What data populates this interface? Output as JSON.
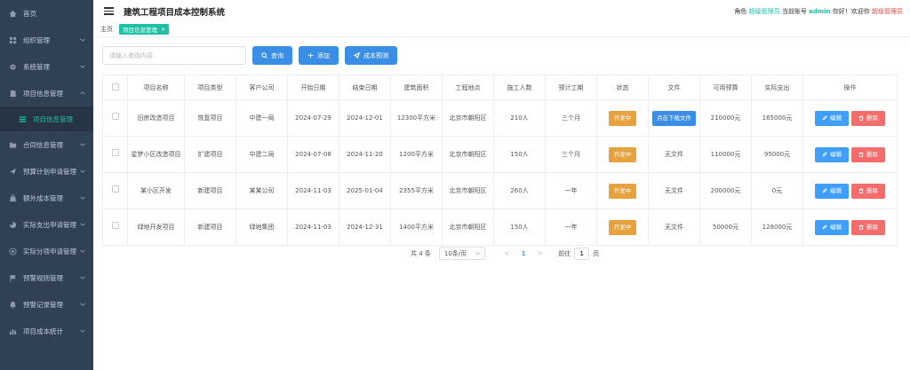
{
  "sidebar": {
    "items": [
      {
        "label": "首页",
        "icon": "home-icon"
      },
      {
        "label": "组织管理",
        "icon": "grid-icon"
      },
      {
        "label": "系统管理",
        "icon": "gear-icon"
      },
      {
        "label": "项目信息管理",
        "icon": "document-icon"
      },
      {
        "label": "项目信息管理",
        "icon": "list-icon"
      },
      {
        "label": "合同信息管理",
        "icon": "folder-icon"
      },
      {
        "label": "预算计划申请管理",
        "icon": "send-icon"
      },
      {
        "label": "额外成本管理",
        "icon": "bag-icon"
      },
      {
        "label": "实际支出申请管理",
        "icon": "pie-icon"
      },
      {
        "label": "实际分项申请管理",
        "icon": "target-icon"
      },
      {
        "label": "预警规则管理",
        "icon": "flag-icon"
      },
      {
        "label": "预警记录管理",
        "icon": "bell-icon"
      },
      {
        "label": "项目成本统计",
        "icon": "chart-icon"
      }
    ]
  },
  "header": {
    "title": "建筑工程项目成本控制系统",
    "role_prefix": "角色",
    "role": "超级管理员",
    "account_prefix": "当前账号",
    "username": "admin",
    "greeting": "你好！欢迎你",
    "logout": "超级管理员"
  },
  "breadcrumb": {
    "home": "主页",
    "tag": "项目信息管理",
    "tag_close": "×"
  },
  "toolbar": {
    "search_placeholder": "请输入查询内容",
    "search_label": "查询",
    "add_label": "添加",
    "predict_label": "成本预测"
  },
  "table": {
    "headers": [
      "",
      "项目名称",
      "项目类型",
      "客户公司",
      "开始日期",
      "结束日期",
      "建筑面积",
      "工程地点",
      "施工人数",
      "预计工期",
      "状态",
      "文件",
      "可用预算",
      "实际支出",
      "操作"
    ],
    "rows": [
      {
        "name": "旧房改造项目",
        "type": "恢复项目",
        "client": "中建一局",
        "start": "2024-07-29",
        "end": "2024-12-01",
        "area": "12300平方米",
        "location": "北京市朝阳区",
        "workers": "210人",
        "duration": "三个月",
        "status": "开发中",
        "file": "点击下载文件",
        "file_is_link": true,
        "budget": "210000元",
        "actual": "165000元"
      },
      {
        "name": "星梦小区改造项目",
        "type": "扩建项目",
        "client": "中建二局",
        "start": "2024-07-08",
        "end": "2024-11-20",
        "area": "1200平方米",
        "location": "北京市朝阳区",
        "workers": "150人",
        "duration": "三个月",
        "status": "开发中",
        "file": "无文件",
        "file_is_link": false,
        "budget": "110000元",
        "actual": "95000元"
      },
      {
        "name": "某小区开发",
        "type": "新建项目",
        "client": "某某公司",
        "start": "2024-11-03",
        "end": "2025-01-04",
        "area": "2355平方米",
        "location": "北京市朝阳区",
        "workers": "260人",
        "duration": "一年",
        "status": "开发中",
        "file": "无文件",
        "file_is_link": false,
        "budget": "200000元",
        "actual": "0元"
      },
      {
        "name": "绿地开发项目",
        "type": "新建项目",
        "client": "绿地集团",
        "start": "2024-11-03",
        "end": "2024-12-31",
        "area": "1400平方米",
        "location": "北京市朝阳区",
        "workers": "150人",
        "duration": "一年",
        "status": "开发中",
        "file": "无文件",
        "file_is_link": false,
        "budget": "50000元",
        "actual": "128000元"
      }
    ],
    "edit_label": "编辑",
    "delete_label": "删除"
  },
  "pagination": {
    "total": "共 4 条",
    "page_size": "10条/页",
    "prev": "<",
    "current": "1",
    "next": ">",
    "goto": "前往",
    "goto_value": "1",
    "unit": "页"
  },
  "colors": {
    "sidebar_bg": "#304156",
    "accent": "#1fbfa6",
    "primary": "#409eff",
    "warning": "#e6a23c",
    "danger": "#f56c6c"
  }
}
